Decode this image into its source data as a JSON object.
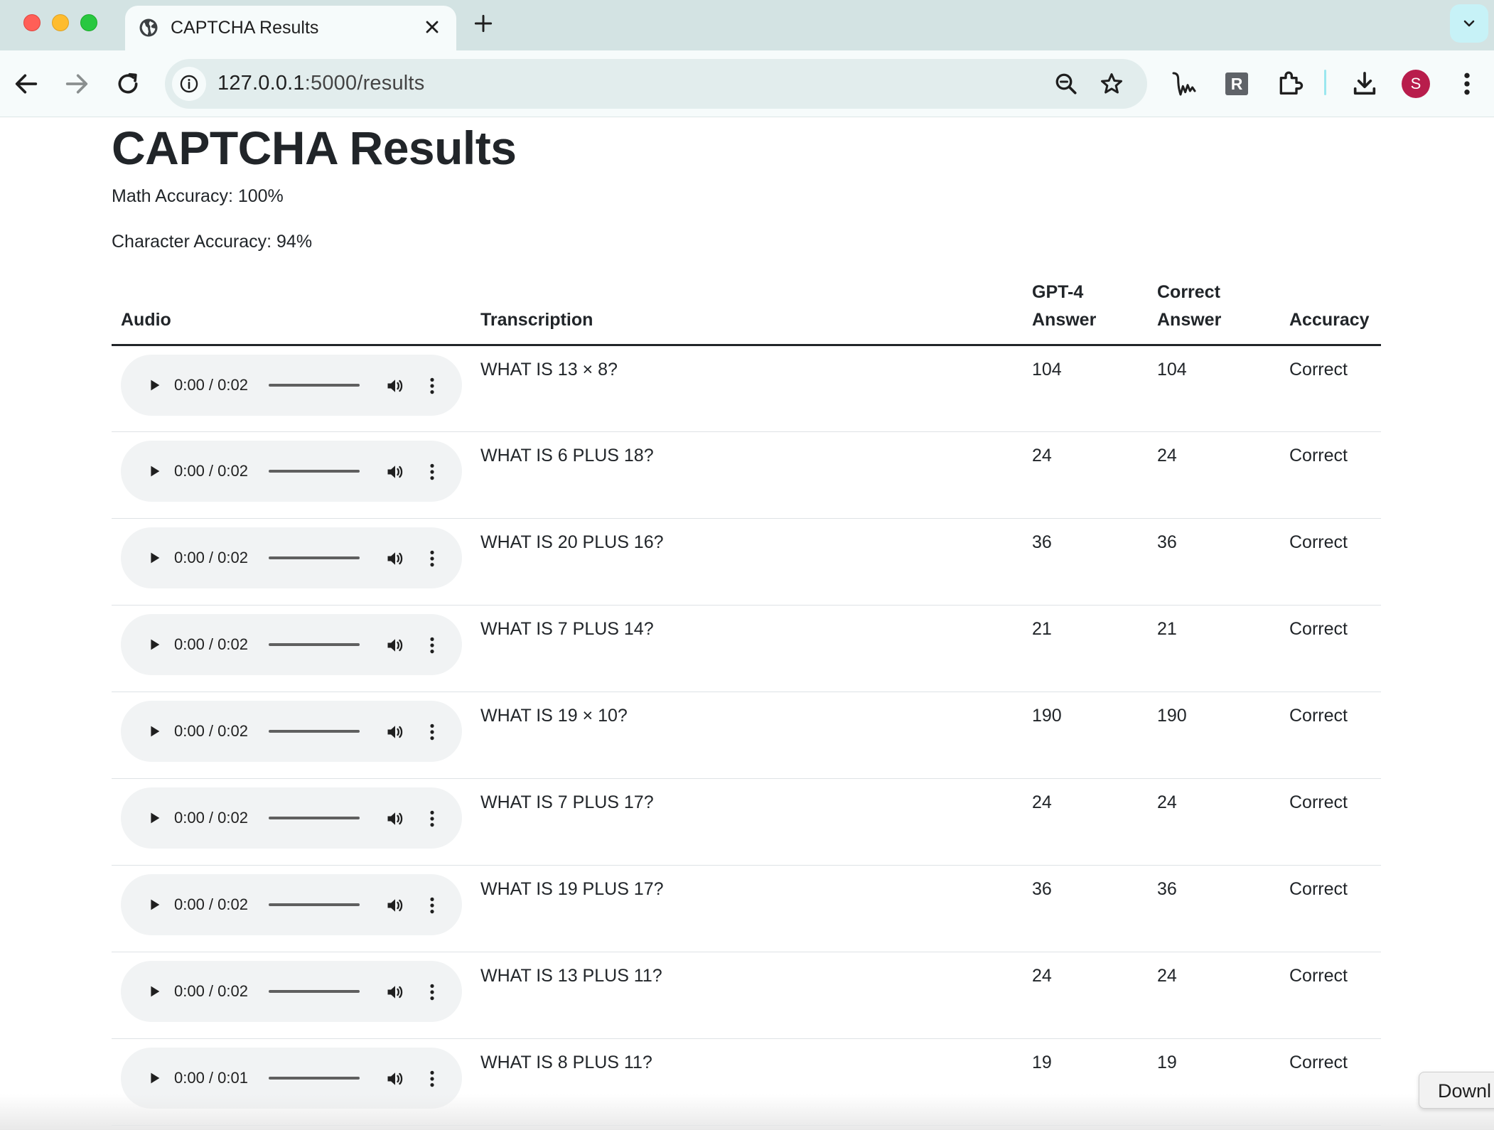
{
  "browser": {
    "tab_title": "CAPTCHA Results",
    "url_host": "127.0.0.1",
    "url_path": ":5000/results",
    "profile_initial": "S",
    "extension_letter": "R"
  },
  "page": {
    "title": "CAPTCHA Results",
    "math_accuracy": "Math Accuracy: 100%",
    "character_accuracy": "Character Accuracy: 94%",
    "table": {
      "headers": {
        "audio": "Audio",
        "transcription": "Transcription",
        "gpt4_line1": "GPT-4",
        "gpt4_line2": "Answer",
        "correct_line1": "Correct",
        "correct_line2": "Answer",
        "accuracy": "Accuracy"
      },
      "rows": [
        {
          "audio_time": "0:00 / 0:02",
          "transcription": "WHAT IS 13 × 8?",
          "gpt4_answer": "104",
          "correct_answer": "104",
          "accuracy": "Correct"
        },
        {
          "audio_time": "0:00 / 0:02",
          "transcription": "WHAT IS 6 PLUS 18?",
          "gpt4_answer": "24",
          "correct_answer": "24",
          "accuracy": "Correct"
        },
        {
          "audio_time": "0:00 / 0:02",
          "transcription": "WHAT IS 20 PLUS 16?",
          "gpt4_answer": "36",
          "correct_answer": "36",
          "accuracy": "Correct"
        },
        {
          "audio_time": "0:00 / 0:02",
          "transcription": "WHAT IS 7 PLUS 14?",
          "gpt4_answer": "21",
          "correct_answer": "21",
          "accuracy": "Correct"
        },
        {
          "audio_time": "0:00 / 0:02",
          "transcription": "WHAT IS 19 × 10?",
          "gpt4_answer": "190",
          "correct_answer": "190",
          "accuracy": "Correct"
        },
        {
          "audio_time": "0:00 / 0:02",
          "transcription": "WHAT IS 7 PLUS 17?",
          "gpt4_answer": "24",
          "correct_answer": "24",
          "accuracy": "Correct"
        },
        {
          "audio_time": "0:00 / 0:02",
          "transcription": "WHAT IS 19 PLUS 17?",
          "gpt4_answer": "36",
          "correct_answer": "36",
          "accuracy": "Correct"
        },
        {
          "audio_time": "0:00 / 0:02",
          "transcription": "WHAT IS 13 PLUS 11?",
          "gpt4_answer": "24",
          "correct_answer": "24",
          "accuracy": "Correct"
        },
        {
          "audio_time": "0:00 / 0:01",
          "transcription": "WHAT IS 8 PLUS 11?",
          "gpt4_answer": "19",
          "correct_answer": "19",
          "accuracy": "Correct"
        }
      ]
    }
  },
  "download_tooltip": "Downl"
}
